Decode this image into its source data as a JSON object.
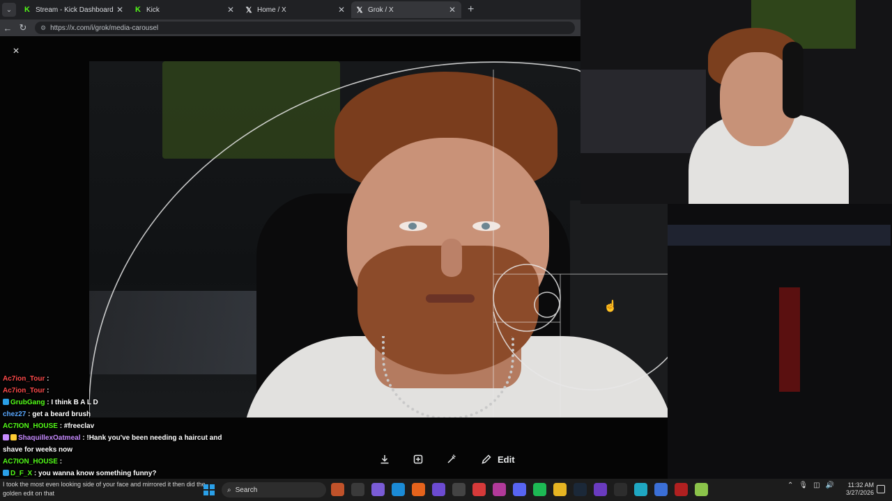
{
  "browser": {
    "tabs": [
      {
        "title": "Stream - Kick Dashboard",
        "favicon": "kick-icon",
        "active": false
      },
      {
        "title": "Kick",
        "favicon": "kick-icon",
        "active": false
      },
      {
        "title": "Home / X",
        "favicon": "x-icon",
        "active": false
      },
      {
        "title": "Grok / X",
        "favicon": "x-icon",
        "active": true
      }
    ],
    "new_tab": "+",
    "url": "https://x.com/i/grok/media-carousel"
  },
  "viewer": {
    "close_label": "×",
    "edit_label": "Edit"
  },
  "chat": [
    {
      "user": "Ac7ion_Tour",
      "text": ":",
      "color": "#ff4a4a"
    },
    {
      "user": "Ac7ion_Tour",
      "text": ":",
      "color": "#ff4a4a"
    },
    {
      "user": "GrubGang",
      "text": ": I think  B  A  L  D",
      "color": "#53fc18"
    },
    {
      "user": "chez27",
      "text": ": get a beard brush",
      "color": "#5aa8ff"
    },
    {
      "user": "AC7ION_HOUSE",
      "text": ": #freeclav",
      "color": "#53fc18"
    },
    {
      "user": "ShaquillexOatmeal",
      "text": ": !Hank you've been needing a haircut and shave for weeks now",
      "color": "#c78bff"
    },
    {
      "user": "AC7ION_HOUSE",
      "text": ":",
      "color": "#53fc18"
    },
    {
      "user": "D_F_X",
      "text": ": you wanna know something funny?",
      "color": "#53fc18"
    }
  ],
  "taskbar": {
    "caption": "I took the most even looking side of your face and mirrored it then did the golden edit on that",
    "search_placeholder": "Search",
    "time": "11:32 AM",
    "date": "3/27/2026"
  },
  "colors": {
    "kick_green": "#53fc18",
    "x_background": "#000000",
    "windows_blue": "#2aa0e8"
  }
}
